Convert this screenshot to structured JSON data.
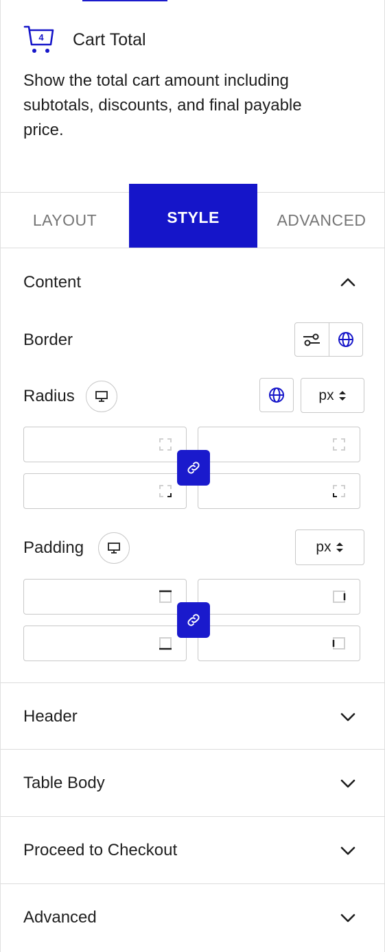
{
  "block": {
    "icon_badge": "4",
    "title": "Cart Total",
    "description": "Show the total cart amount including subtotals, discounts, and final payable price."
  },
  "tabs": [
    {
      "label": "LAYOUT",
      "active": false
    },
    {
      "label": "STYLE",
      "active": true
    },
    {
      "label": "ADVANCED",
      "active": false
    }
  ],
  "content_section": {
    "title": "Content",
    "expanded": true,
    "border_label": "Border",
    "radius_label": "Radius",
    "radius_unit": "px",
    "padding_label": "Padding",
    "padding_unit": "px"
  },
  "collapsed_sections": [
    {
      "label": "Header"
    },
    {
      "label": "Table Body"
    },
    {
      "label": "Proceed to Checkout"
    },
    {
      "label": "Advanced"
    }
  ],
  "colors": {
    "accent": "#1515c9",
    "border": "#c8c8c8",
    "text": "#1e1e1e",
    "muted": "#757575"
  }
}
